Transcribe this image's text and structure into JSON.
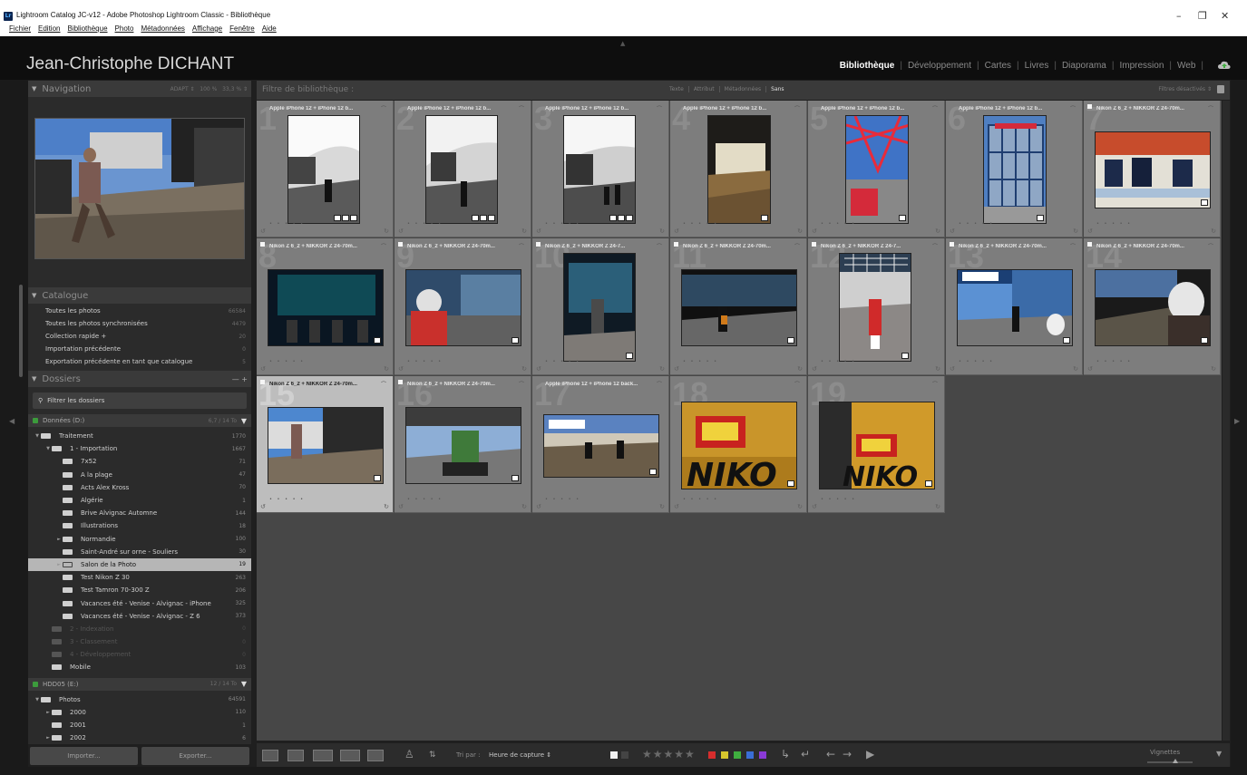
{
  "window": {
    "app_icon": "Lr",
    "title": "Lightroom Catalog JC-v12 - Adobe Photoshop Lightroom Classic - Bibliothèque",
    "menu": [
      "Fichier",
      "Edition",
      "Bibliothèque",
      "Photo",
      "Métadonnées",
      "Affichage",
      "Fenêtre",
      "Aide"
    ],
    "controls": [
      "minimize-icon",
      "restore-icon",
      "close-icon"
    ]
  },
  "identity_plate": "Jean-Christophe DICHANT",
  "modules": [
    "Bibliothèque",
    "Développement",
    "Cartes",
    "Livres",
    "Diaporama",
    "Impression",
    "Web"
  ],
  "active_module": "Bibliothèque",
  "navigator": {
    "title": "Navigation",
    "zoom": [
      "ADAPT ⇕",
      "100 %",
      "33,3 % ⇕"
    ]
  },
  "catalog": {
    "title": "Catalogue",
    "rows": [
      {
        "label": "Toutes les photos",
        "count": "66584"
      },
      {
        "label": "Toutes les photos synchronisées",
        "count": "4479"
      },
      {
        "label": "Collection rapide +",
        "count": "20"
      },
      {
        "label": "Importation précédente",
        "count": "0"
      },
      {
        "label": "Exportation précédente en tant que catalogue",
        "count": "5"
      }
    ]
  },
  "folders": {
    "title": "Dossiers",
    "actions": "—  +",
    "filter_placeholder": "Filtrer les dossiers",
    "volumes": [
      {
        "name": "Données (D:)",
        "capacity": "6,7 / 14 To",
        "rows": [
          {
            "label": "Traitement",
            "count": "1770",
            "twisty": "▼"
          },
          {
            "label": "1 - Importation",
            "count": "1667",
            "twisty": "▼"
          },
          {
            "label": "7x52",
            "count": "71",
            "twisty": ""
          },
          {
            "label": "A la plage",
            "count": "47",
            "twisty": ""
          },
          {
            "label": "Acts Alex Kross",
            "count": "70",
            "twisty": ""
          },
          {
            "label": "Algérie",
            "count": "1",
            "twisty": ""
          },
          {
            "label": "Brive Alvignac Automne",
            "count": "144",
            "twisty": ""
          },
          {
            "label": "Illustrations",
            "count": "18",
            "twisty": ""
          },
          {
            "label": "Normandie",
            "count": "100",
            "twisty": "►"
          },
          {
            "label": "Saint-André sur orne - Souliers",
            "count": "30",
            "twisty": ""
          },
          {
            "label": "Salon de la Photo",
            "count": "19",
            "twisty": "►"
          },
          {
            "label": "Test Nikon Z 30",
            "count": "263",
            "twisty": ""
          },
          {
            "label": "Test Tamron 70-300 Z",
            "count": "206",
            "twisty": ""
          },
          {
            "label": "Vacances été - Venise - Alvignac - iPhone",
            "count": "325",
            "twisty": ""
          },
          {
            "label": "Vacances été - Venise - Alvignac - Z 6",
            "count": "373",
            "twisty": ""
          },
          {
            "label": "2 - Indexation",
            "count": "0",
            "twisty": ""
          },
          {
            "label": "3 - Classement",
            "count": "0",
            "twisty": ""
          },
          {
            "label": "4 - Développement",
            "count": "0",
            "twisty": ""
          },
          {
            "label": "Mobile",
            "count": "103",
            "twisty": ""
          }
        ]
      },
      {
        "name": "HDD05 (E:)",
        "capacity": "12 / 14 To",
        "rows": [
          {
            "label": "Photos",
            "count": "64591",
            "twisty": "▼"
          },
          {
            "label": "2000",
            "count": "110",
            "twisty": "►"
          },
          {
            "label": "2001",
            "count": "1",
            "twisty": ""
          },
          {
            "label": "2002",
            "count": "6",
            "twisty": "►"
          }
        ]
      }
    ]
  },
  "left_buttons": {
    "import": "Importer...",
    "export": "Exporter..."
  },
  "filter_bar": {
    "label": "Filtre de bibliothèque :",
    "tabs": [
      "Texte",
      "Attribut",
      "Métadonnées",
      "Sans"
    ],
    "active_tab": "Sans",
    "right": "Filtres désactivés ⇕"
  },
  "grid": {
    "cells": [
      {
        "num": "1",
        "caption": "Apple iPhone 12 + iPhone 12 b...",
        "selected": false,
        "flag": false
      },
      {
        "num": "2",
        "caption": "Apple iPhone 12 + iPhone 12 b...",
        "selected": false,
        "flag": false
      },
      {
        "num": "3",
        "caption": "Apple iPhone 12 + iPhone 12 b...",
        "selected": false,
        "flag": false
      },
      {
        "num": "4",
        "caption": "Apple iPhone 12 + iPhone 12 b...",
        "selected": false,
        "flag": false
      },
      {
        "num": "5",
        "caption": "Apple iPhone 12 + iPhone 12 b...",
        "selected": false,
        "flag": false
      },
      {
        "num": "6",
        "caption": "Apple iPhone 12 + iPhone 12 b...",
        "selected": false,
        "flag": false
      },
      {
        "num": "7",
        "caption": "Nikon Z 6_2 + NIKKOR Z 24-70m...",
        "selected": false,
        "flag": true
      },
      {
        "num": "8",
        "caption": "Nikon Z 6_2 + NIKKOR Z 24-70m...",
        "selected": false,
        "flag": true
      },
      {
        "num": "9",
        "caption": "Nikon Z 6_2 + NIKKOR Z 24-70m...",
        "selected": false,
        "flag": true
      },
      {
        "num": "10",
        "caption": "Nikon Z 6_2 + NIKKOR Z 24-7...",
        "selected": false,
        "flag": true
      },
      {
        "num": "11",
        "caption": "Nikon Z 6_2 + NIKKOR Z 24-70m...",
        "selected": false,
        "flag": true
      },
      {
        "num": "12",
        "caption": "Nikon Z 6_2 + NIKKOR Z 24-7...",
        "selected": false,
        "flag": true
      },
      {
        "num": "13",
        "caption": "Nikon Z 6_2 + NIKKOR Z 24-70m...",
        "selected": false,
        "flag": true
      },
      {
        "num": "14",
        "caption": "Nikon Z 6_2 + NIKKOR Z 24-70m...",
        "selected": false,
        "flag": true
      },
      {
        "num": "15",
        "caption": "Nikon Z 6_2 + NIKKOR Z 24-70m...",
        "selected": true,
        "flag": true
      },
      {
        "num": "16",
        "caption": "Nikon Z 6_2 + NIKKOR Z 24-70m...",
        "selected": false,
        "flag": true
      },
      {
        "num": "17",
        "caption": "Apple iPhone 12 + iPhone 12 back...",
        "selected": false,
        "flag": false
      },
      {
        "num": "18",
        "caption": "",
        "selected": false,
        "flag": false
      },
      {
        "num": "19",
        "caption": "",
        "selected": false,
        "flag": false
      }
    ]
  },
  "toolbar": {
    "sort_label": "Tri par :",
    "sort_value": "Heure de capture ⇕",
    "stars": "★★★★★",
    "color_labels": [
      "#d62d2d",
      "#d6c62d",
      "#3fae3f",
      "#3a6ed6",
      "#8a3ad6"
    ],
    "thumbnails_label": "Vignettes"
  },
  "colors": {
    "app_bg": "#1f1f1f",
    "panel": "#2b2b2b",
    "grid_bg": "#474747",
    "cell": "#7d7d7d",
    "cell_selected": "#bdbdbd"
  }
}
